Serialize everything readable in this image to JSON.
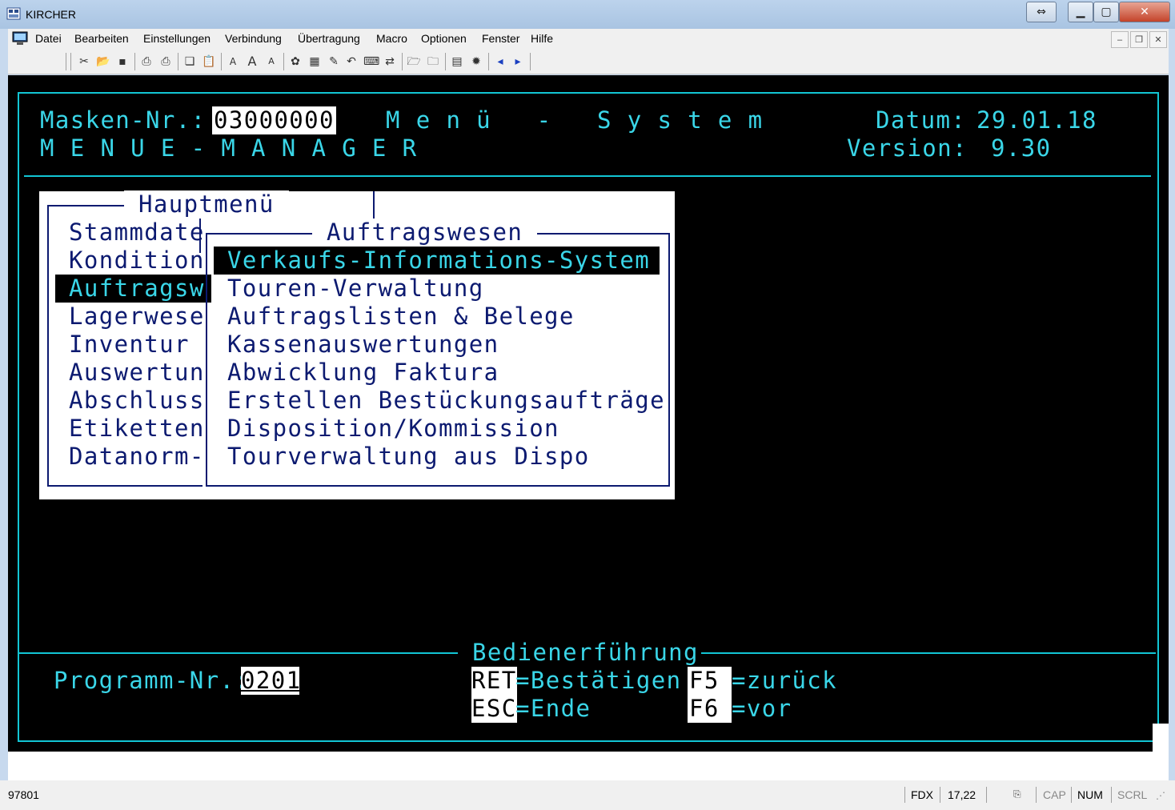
{
  "window": {
    "title": "KIRCHER"
  },
  "menubar": {
    "items": [
      "Datei",
      "Bearbeiten",
      "Einstellungen",
      "Verbindung",
      "Übertragung",
      "Macro",
      "Optionen",
      "Fenster",
      "Hilfe"
    ]
  },
  "header": {
    "masken_label": "Masken-Nr.:",
    "masken_value": "03000000",
    "system_title": "M e n ü   -   S y s t e m",
    "datum_label": "Datum:",
    "datum_value": "29.01.18",
    "manager_title": "M E N U E - M A N A G E R",
    "version_label": "Version:",
    "version_value": "9.30"
  },
  "hauptmenu": {
    "title": "Hauptmenü",
    "items": [
      "Stammdate",
      "Kondition",
      "Auftragsw",
      "Lagerwese",
      "Inventur",
      "Auswertun",
      "Abschluss",
      "Etiketten",
      "Datanorm-"
    ],
    "selected_index": 2
  },
  "auftragswesen": {
    "title": "Auftragswesen",
    "items": [
      "Verkaufs-Informations-System",
      "Touren-Verwaltung",
      "Auftragslisten & Belege",
      "Kassenauswertungen",
      "Abwicklung Faktura",
      "Erstellen Bestückungsaufträge",
      "Disposition/Kommission",
      "Tourverwaltung aus Dispo"
    ],
    "selected_index": 0
  },
  "footer": {
    "guide_title": "Bedienerführung",
    "programm_label": "Programm-Nr.:",
    "programm_value": "0201",
    "keys": {
      "ret": "RET",
      "ret_desc": "=Bestätigen",
      "f5": "F5",
      "f5_desc": "=zurück",
      "esc": "ESC",
      "esc_desc": "=Ende",
      "f6": "F6",
      "f6_desc": "=vor"
    }
  },
  "statusbar": {
    "left": "97801",
    "mode": "FDX",
    "position": "17,22",
    "cap": "CAP",
    "num": "NUM",
    "scrl": "SCRL"
  },
  "colors": {
    "terminal_fg": "#3ad6e8",
    "terminal_bg": "#000000",
    "menu_fg": "#0c1a70"
  }
}
